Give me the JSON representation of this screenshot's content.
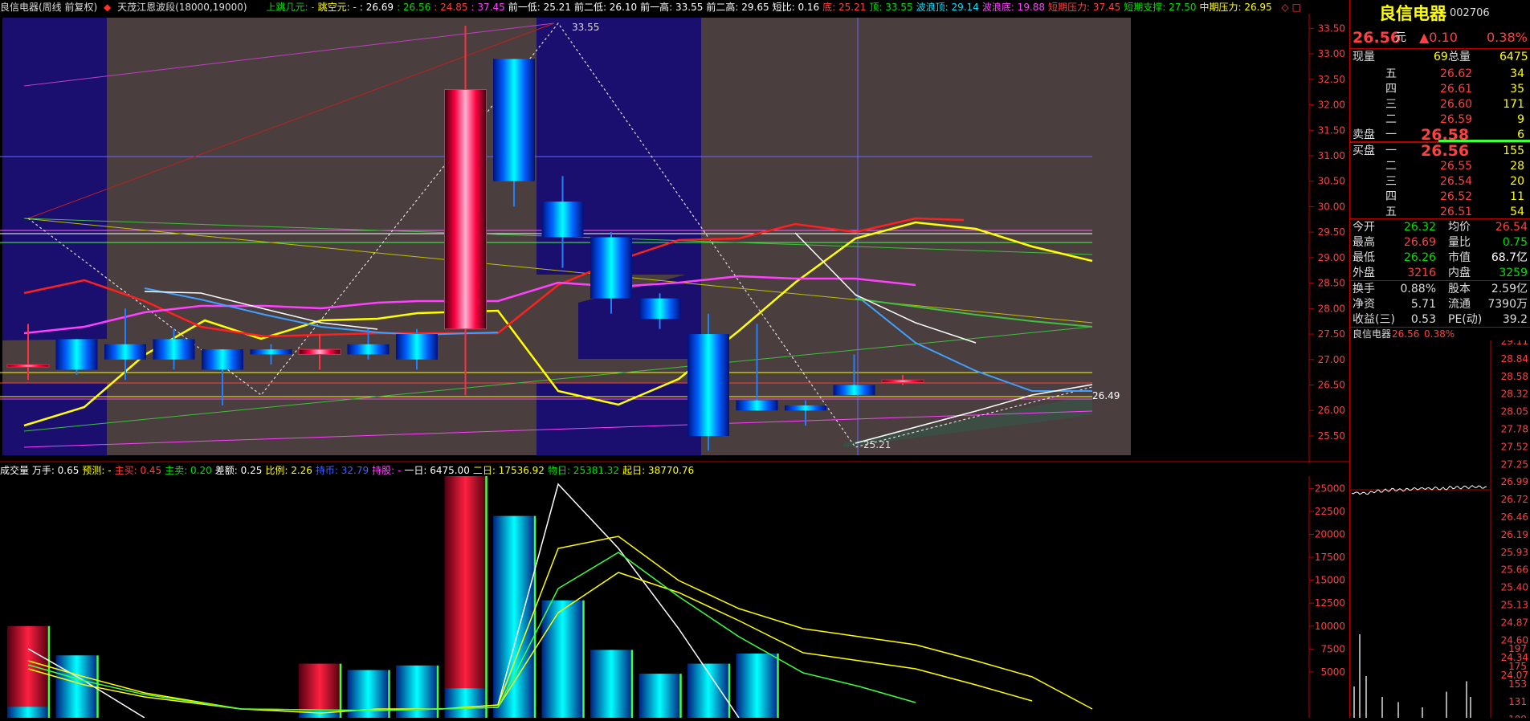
{
  "topbar": {
    "stock": "良信电器(周线 前复权)",
    "indicator": "天茂江恩波段(18000,19000)",
    "items": [
      {
        "label": "上跳几元: -",
        "color": "#00e000"
      },
      {
        "label": "跳空元: -",
        "color": "#ffff00"
      },
      {
        "label": ": 26.69",
        "color": "#ffffff"
      },
      {
        "label": ": 26.56",
        "color": "#00e000"
      },
      {
        "label": ": 24.85",
        "color": "#ff4040"
      },
      {
        "label": ": 37.45",
        "color": "#ff40ff"
      },
      {
        "label": "前一低: 25.21",
        "color": "#ffffff"
      },
      {
        "label": "前二低: 26.10",
        "color": "#ffffff"
      },
      {
        "label": "前一高: 33.55",
        "color": "#ffffff"
      },
      {
        "label": "前二高: 29.65",
        "color": "#ffffff"
      },
      {
        "label": "短比: 0.16",
        "color": "#ffffff"
      },
      {
        "label": "底: 25.21",
        "color": "#ff4040"
      },
      {
        "label": "顶: 33.55",
        "color": "#00e000"
      },
      {
        "label": "波浪顶: 29.14",
        "color": "#00e0ff"
      },
      {
        "label": "波浪底: 19.88",
        "color": "#ff40ff"
      },
      {
        "label": "短期压力: 37.45",
        "color": "#ff4040"
      },
      {
        "label": "短期支撑: 27.50",
        "color": "#00e000"
      },
      {
        "label": "中期压力: 26.95",
        "color": "#ffff00"
      }
    ],
    "icons": "◇ □"
  },
  "price_axis": [
    "33.50",
    "33.00",
    "32.50",
    "32.00",
    "31.50",
    "31.00",
    "30.50",
    "30.00",
    "29.50",
    "29.00",
    "28.50",
    "28.00",
    "27.50",
    "27.00",
    "26.50",
    "26.00",
    "25.50"
  ],
  "price_labels": {
    "high": "33.55",
    "low": "25.21",
    "last": "26.49"
  },
  "vol_header": {
    "items": [
      {
        "label": "成交量 万手: 0.65",
        "color": "#ffffff"
      },
      {
        "label": "预测: -",
        "color": "#ffff00"
      },
      {
        "label": "主买: 0.45",
        "color": "#ff4040"
      },
      {
        "label": "主卖: 0.20",
        "color": "#00e000"
      },
      {
        "label": "差额: 0.25",
        "color": "#ffffff"
      },
      {
        "label": "比例: 2.26",
        "color": "#ffff00"
      },
      {
        "label": "持币: 32.79",
        "color": "#4060ff"
      },
      {
        "label": "持股: -",
        "color": "#ff40ff"
      },
      {
        "label": "一日: 6475.00",
        "color": "#ffffff"
      },
      {
        "label": "二日: 17536.92",
        "color": "#ffff00"
      },
      {
        "label": "物日: 25381.32",
        "color": "#00e000"
      },
      {
        "label": "起日: 38770.76",
        "color": "#ffff00"
      }
    ]
  },
  "vol_axis": [
    "25000",
    "22500",
    "20000",
    "17500",
    "15000",
    "12500",
    "10000",
    "7500",
    "5000"
  ],
  "right_panel": {
    "name": "良信电器",
    "code": "002706",
    "price": "26.56",
    "unit": "元",
    "change": "▲0.10",
    "pct": "0.38%",
    "xianliang_label": "现量",
    "xianliang": "69",
    "zongliang_label": "总量",
    "zongliang": "6475",
    "sell": [
      {
        "lvl": "五",
        "price": "26.62",
        "vol": "34"
      },
      {
        "lvl": "四",
        "price": "26.61",
        "vol": "35"
      },
      {
        "lvl": "三",
        "price": "26.60",
        "vol": "171"
      },
      {
        "lvl": "二",
        "price": "26.59",
        "vol": "9"
      },
      {
        "lvl": "一",
        "price": "26.58",
        "vol": "6"
      }
    ],
    "sell_label": "卖盘",
    "buy_label": "买盘",
    "buy": [
      {
        "lvl": "一",
        "price": "26.56",
        "vol": "155"
      },
      {
        "lvl": "二",
        "price": "26.55",
        "vol": "28"
      },
      {
        "lvl": "三",
        "price": "26.54",
        "vol": "20"
      },
      {
        "lvl": "四",
        "price": "26.52",
        "vol": "11"
      },
      {
        "lvl": "五",
        "price": "26.51",
        "vol": "54"
      }
    ],
    "stats": [
      {
        "l1": "今开",
        "v1": "26.32",
        "c1": "#00e000",
        "l2": "均价",
        "v2": "26.54",
        "c2": "#ff4040"
      },
      {
        "l1": "最高",
        "v1": "26.69",
        "c1": "#ff4040",
        "l2": "量比",
        "v2": "0.75",
        "c2": "#00e000"
      },
      {
        "l1": "最低",
        "v1": "26.26",
        "c1": "#00e000",
        "l2": "市值",
        "v2": "68.7亿",
        "c2": "#ffffff"
      },
      {
        "l1": "外盘",
        "v1": "3216",
        "c1": "#ff4040",
        "l2": "内盘",
        "v2": "3259",
        "c2": "#00e000"
      }
    ],
    "stats2": [
      {
        "l1": "换手",
        "v1": "0.88%",
        "l2": "股本",
        "v2": "2.59亿"
      },
      {
        "l1": "净资",
        "v1": "5.71",
        "l2": "流通",
        "v2": "7390万"
      },
      {
        "l1": "收益(三)",
        "v1": "0.53",
        "l2": "PE(动)",
        "v2": "39.2"
      }
    ],
    "mini_title": "良信电器",
    "mini_price": "26.56",
    "mini_pct": "0.38%",
    "mini_axis_top": [
      "29.11",
      "28.84",
      "28.58",
      "28.32",
      "28.05",
      "27.78",
      "27.52",
      "27.25",
      "26.99",
      "26.72",
      "26.46",
      "26.19",
      "25.93",
      "25.66",
      "25.40",
      "25.13",
      "24.87",
      "24.60",
      "24.34",
      "24.07"
    ],
    "mini_axis_vol": [
      "197",
      "175",
      "153",
      "131",
      "109"
    ]
  },
  "chart_data": {
    "type": "candlestick",
    "candles": [
      {
        "o": 26.9,
        "c": 26.9,
        "h": 27.7,
        "l": 26.6
      },
      {
        "o": 27.4,
        "c": 26.8,
        "h": 27.4,
        "l": 26.7
      },
      {
        "o": 27.3,
        "c": 27.0,
        "h": 28.0,
        "l": 26.6
      },
      {
        "o": 27.4,
        "c": 27.0,
        "h": 27.6,
        "l": 26.8
      },
      {
        "o": 27.2,
        "c": 26.8,
        "h": 27.2,
        "l": 26.1
      },
      {
        "o": 27.2,
        "c": 27.1,
        "h": 27.3,
        "l": 26.9
      },
      {
        "o": 27.1,
        "c": 27.2,
        "h": 27.5,
        "l": 26.8
      },
      {
        "o": 27.3,
        "c": 27.1,
        "h": 27.6,
        "l": 27.0
      },
      {
        "o": 27.5,
        "c": 27.0,
        "h": 27.6,
        "l": 26.8
      },
      {
        "o": 27.6,
        "c": 32.3,
        "h": 33.55,
        "l": 26.3
      },
      {
        "o": 32.9,
        "c": 30.5,
        "h": 32.9,
        "l": 30.0
      },
      {
        "o": 30.1,
        "c": 29.4,
        "h": 30.6,
        "l": 28.8
      },
      {
        "o": 29.4,
        "c": 28.2,
        "h": 29.5,
        "l": 27.9
      },
      {
        "o": 28.2,
        "c": 27.8,
        "h": 28.3,
        "l": 27.6
      },
      {
        "o": 27.5,
        "c": 25.5,
        "h": 27.9,
        "l": 25.21
      },
      {
        "o": 26.2,
        "c": 26.0,
        "h": 27.7,
        "l": 26.0
      },
      {
        "o": 26.1,
        "c": 26.0,
        "h": 26.2,
        "l": 25.7
      },
      {
        "o": 26.5,
        "c": 26.3,
        "h": 27.1,
        "l": 26.3
      },
      {
        "o": 26.6,
        "c": 26.6,
        "h": 26.7,
        "l": 26.5
      }
    ],
    "volumes": [
      10000,
      6800,
      0,
      0,
      0,
      0,
      5900,
      5200,
      5700,
      26800,
      22000,
      12800,
      7400,
      4800,
      5900,
      7000,
      0,
      0,
      0
    ],
    "ylim": [
      25.2,
      33.6
    ]
  }
}
